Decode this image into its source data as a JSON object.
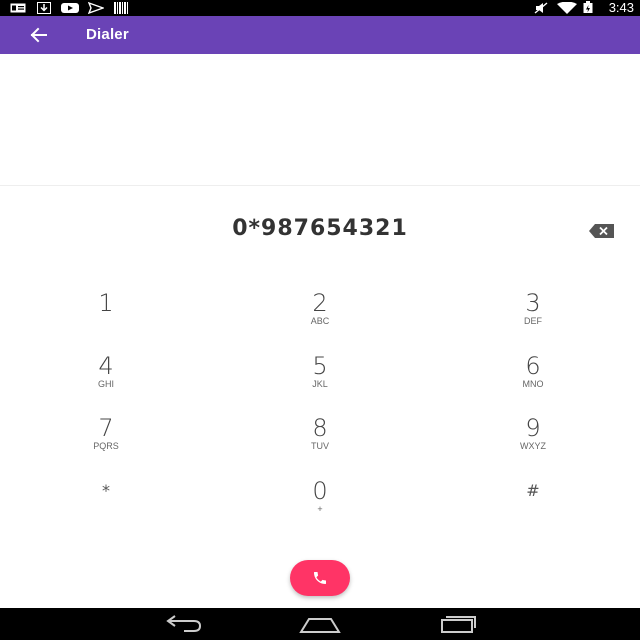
{
  "status_bar": {
    "time": "3:43",
    "left_icons": [
      "id-card-icon",
      "download-icon",
      "youtube-icon",
      "send-icon",
      "barcode-icon"
    ],
    "right_icons": [
      "mute-icon",
      "wifi-icon",
      "battery-icon"
    ]
  },
  "app_bar": {
    "title": "Dialer",
    "back_icon": "arrow-left-icon",
    "color": "#6a43b6"
  },
  "display": {
    "number": "0*987654321",
    "backspace_icon": "backspace-icon"
  },
  "keypad": {
    "keys": [
      {
        "digit": "1",
        "letters": ""
      },
      {
        "digit": "2",
        "letters": "ABC"
      },
      {
        "digit": "3",
        "letters": "DEF"
      },
      {
        "digit": "4",
        "letters": "GHI"
      },
      {
        "digit": "5",
        "letters": "JKL"
      },
      {
        "digit": "6",
        "letters": "MNO"
      },
      {
        "digit": "7",
        "letters": "PQRS"
      },
      {
        "digit": "8",
        "letters": "TUV"
      },
      {
        "digit": "9",
        "letters": "WXYZ"
      },
      {
        "digit": "*",
        "letters": ""
      },
      {
        "digit": "0",
        "letters": "+"
      },
      {
        "digit": "#",
        "letters": ""
      }
    ]
  },
  "call_button": {
    "icon": "phone-icon",
    "color": "#ff3466"
  },
  "nav_bar": {
    "buttons": [
      "back-icon",
      "home-icon",
      "recents-icon"
    ]
  }
}
